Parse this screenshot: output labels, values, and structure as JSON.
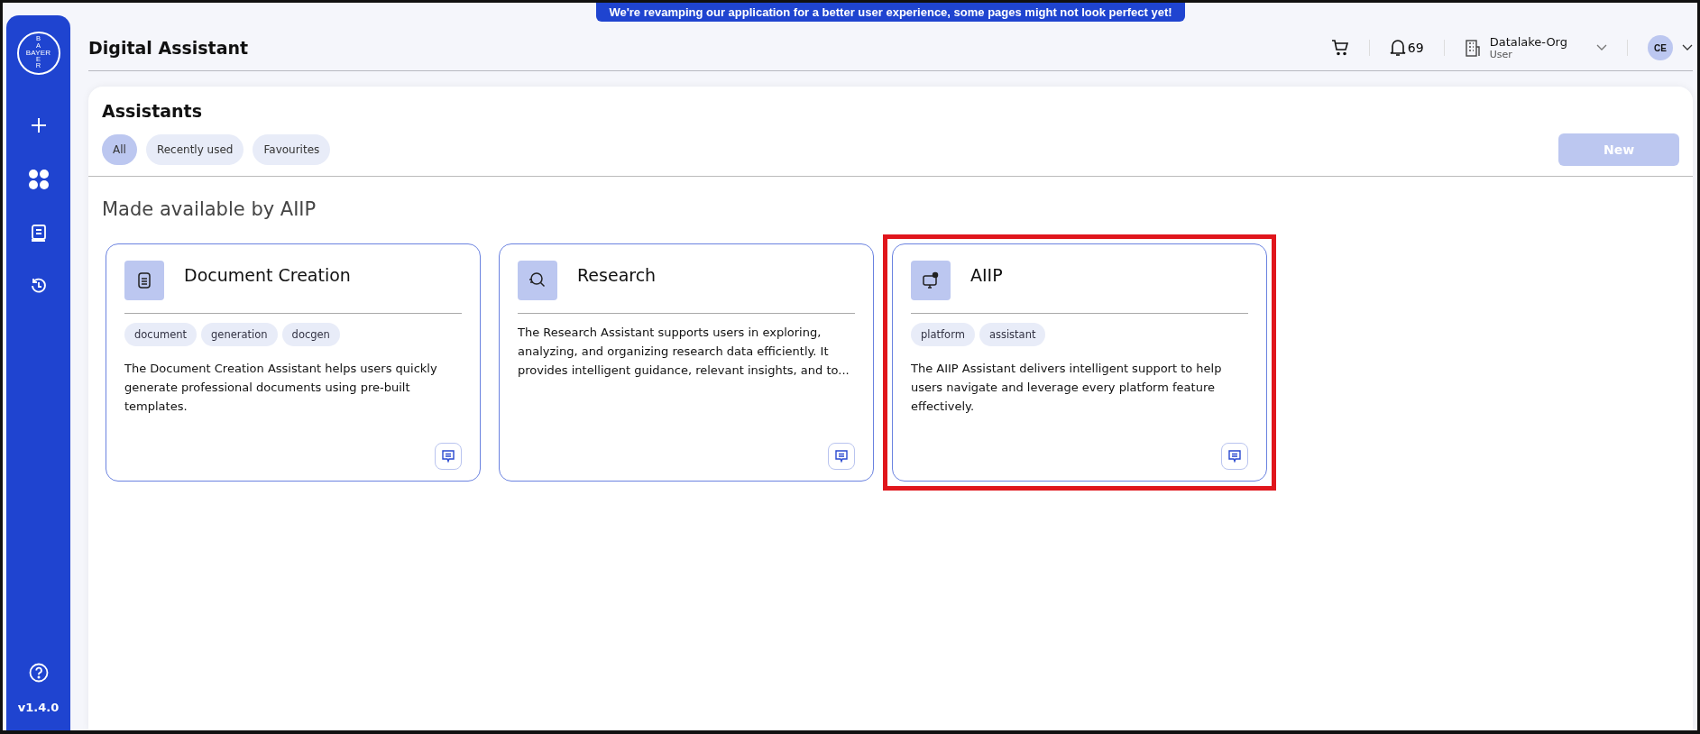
{
  "banner": "We're revamping our application for a better user experience, some pages might not look perfect yet!",
  "sidebar": {
    "logo": {
      "horizontal": "BAYER",
      "vertical": "BAYER"
    },
    "items": [
      {
        "kind": "plus"
      },
      {
        "kind": "grid"
      },
      {
        "kind": "book"
      },
      {
        "kind": "history"
      }
    ],
    "version": "v1.4.0"
  },
  "header": {
    "title": "Digital Assistant",
    "notifications": "69",
    "org": {
      "name": "Datalake-Org",
      "role": "User"
    },
    "avatar": "CE"
  },
  "panel": {
    "title": "Assistants",
    "filters": [
      {
        "label": "All",
        "selected": true
      },
      {
        "label": "Recently used",
        "selected": false
      },
      {
        "label": "Favourites",
        "selected": false
      }
    ],
    "new_button": {
      "label": "New",
      "disabled": true
    },
    "section_title": "Made available by AIIP",
    "cards": [
      {
        "kind": "document",
        "title": "Document Creation",
        "tags": [
          "document",
          "generation",
          "docgen"
        ],
        "description": "The Document Creation Assistant helps users quickly generate professional documents using pre-built templates.",
        "highlighted": false
      },
      {
        "kind": "research",
        "title": "Research",
        "description": "The Research Assistant supports users in exploring, analyzing, and organizing research data efficiently. It provides intelligent guidance, relevant insights, and to...",
        "highlighted": false
      },
      {
        "kind": "platform",
        "title": "AIIP",
        "tags": [
          "platform",
          "assistant"
        ],
        "description": "The AIIP Assistant delivers intelligent support to help users navigate and leverage every platform feature effectively.",
        "highlighted": true
      }
    ]
  }
}
